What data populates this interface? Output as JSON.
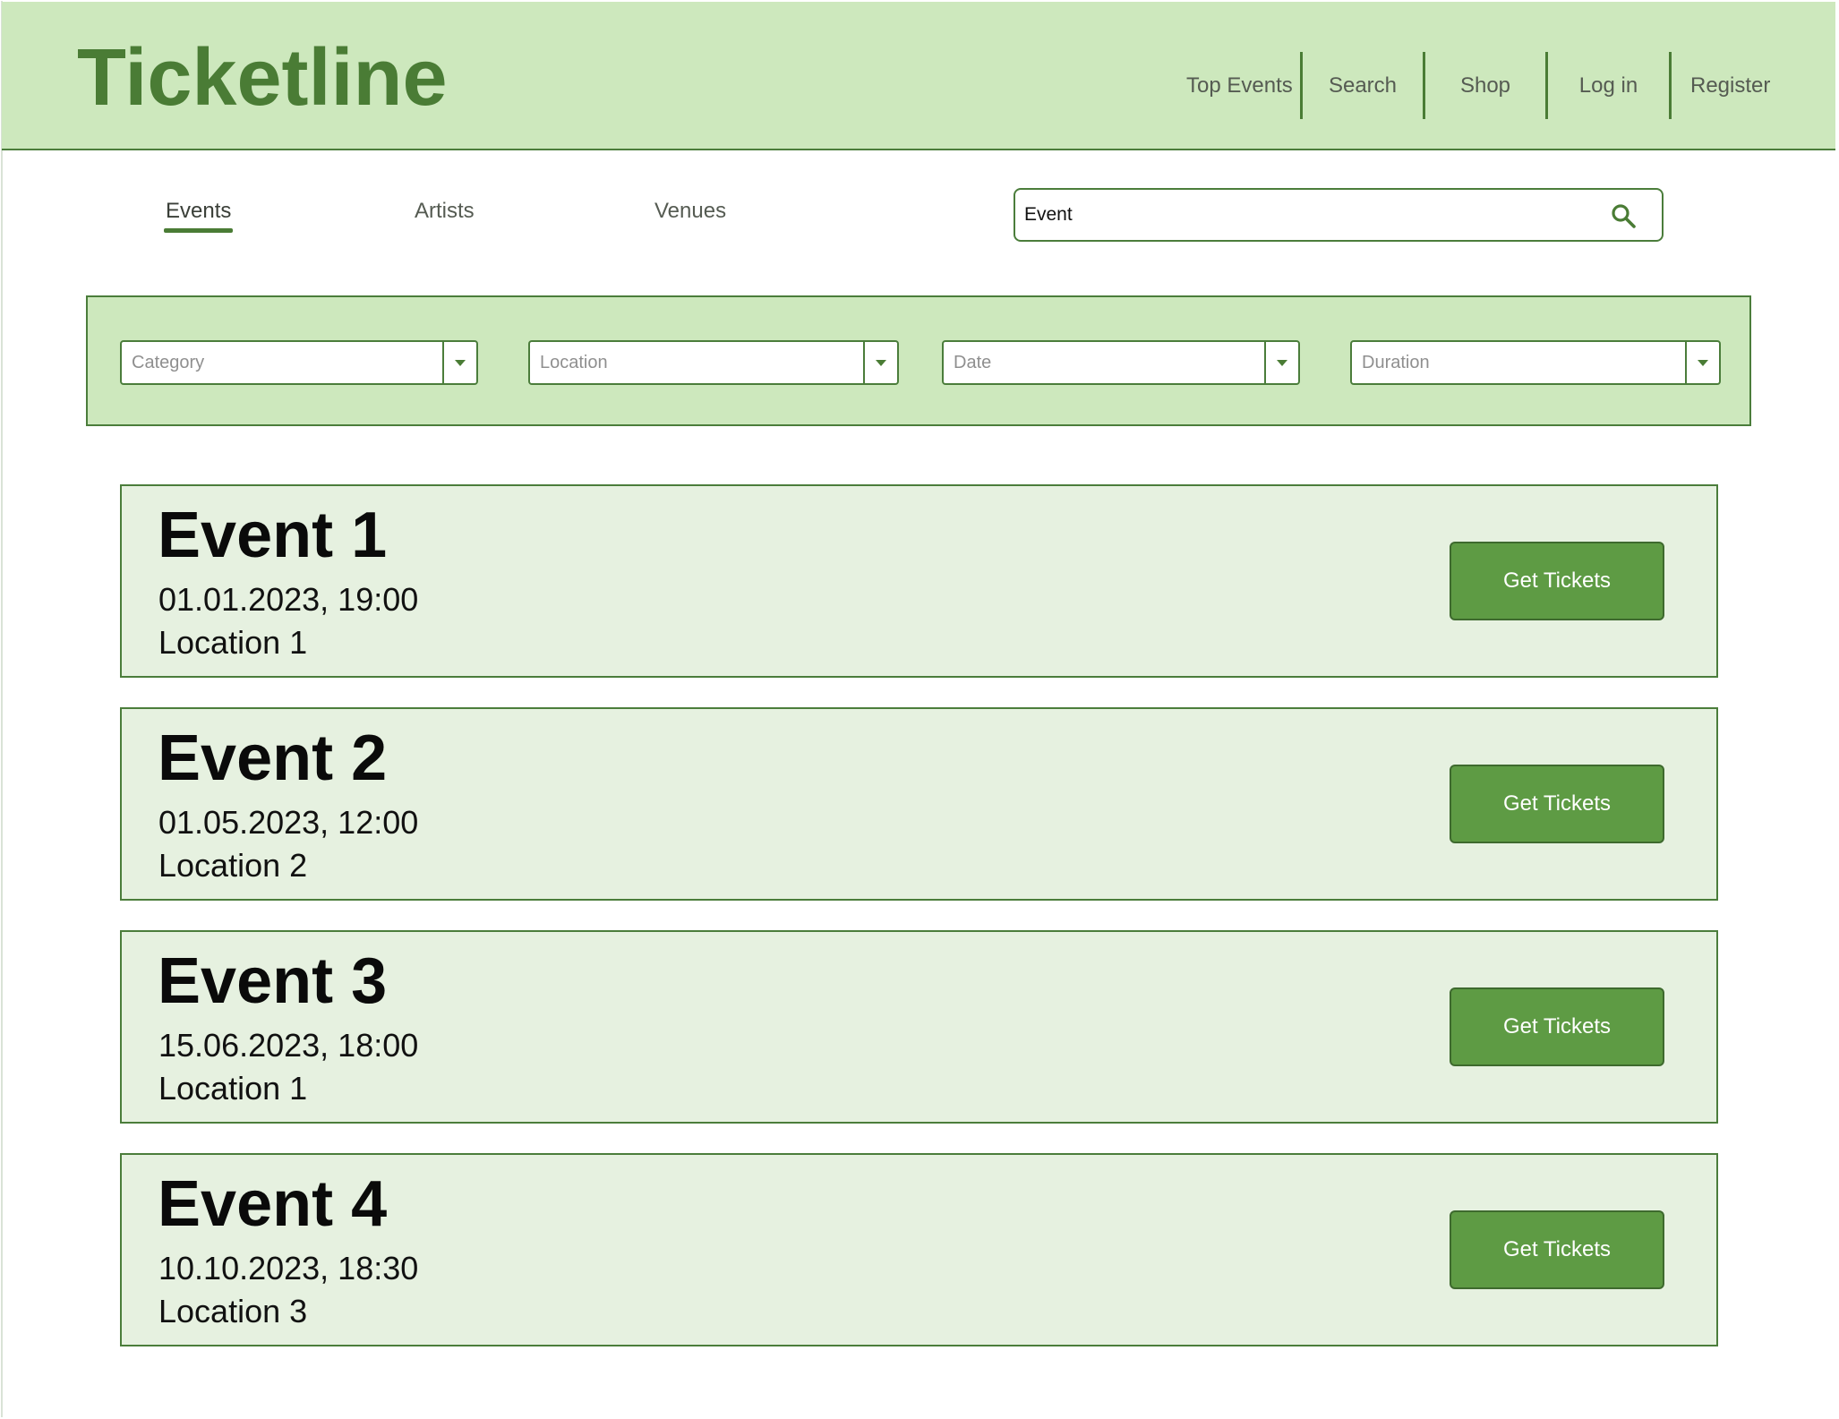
{
  "app": {
    "title": "Ticketline"
  },
  "top_nav": {
    "items": [
      {
        "label": "Top Events"
      },
      {
        "label": "Search"
      },
      {
        "label": "Shop"
      },
      {
        "label": "Log in"
      },
      {
        "label": "Register"
      }
    ]
  },
  "tabs": [
    {
      "label": "Events",
      "active": true
    },
    {
      "label": "Artists",
      "active": false
    },
    {
      "label": "Venues",
      "active": false
    }
  ],
  "search": {
    "value": "Event",
    "icon": "search-icon"
  },
  "filters": [
    {
      "placeholder": "Category"
    },
    {
      "placeholder": "Location"
    },
    {
      "placeholder": "Date"
    },
    {
      "placeholder": "Duration"
    }
  ],
  "events": [
    {
      "title": "Event 1",
      "datetime": "01.01.2023, 19:00",
      "location": "Location 1",
      "button_label": "Get Tickets"
    },
    {
      "title": "Event 2",
      "datetime": "01.05.2023, 12:00",
      "location": "Location 2",
      "button_label": "Get Tickets"
    },
    {
      "title": "Event 3",
      "datetime": "15.06.2023, 18:00",
      "location": "Location 1",
      "button_label": "Get Tickets"
    },
    {
      "title": "Event 4",
      "datetime": "10.10.2023, 18:30",
      "location": "Location 3",
      "button_label": "Get Tickets"
    }
  ],
  "colors": {
    "header_bg": "#cde8bd",
    "brand_green": "#4a7c35",
    "card_bg": "#e6f1e0",
    "button_bg": "#5e9b44"
  }
}
